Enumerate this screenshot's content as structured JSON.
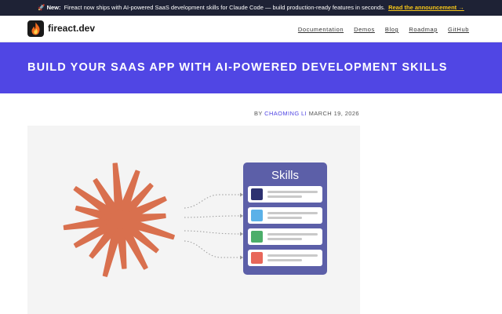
{
  "announcement": {
    "badge": "New:",
    "text": "Fireact now ships with AI-powered SaaS development skills for Claude Code — build production-ready features in seconds.",
    "link_label": "Read the announcement →"
  },
  "brand": {
    "name": "fireact.dev",
    "logo_icon": "flame-icon"
  },
  "nav": {
    "items": [
      {
        "label": "Documentation"
      },
      {
        "label": "Demos"
      },
      {
        "label": "Blog"
      },
      {
        "label": "Roadmap"
      },
      {
        "label": "GitHub"
      }
    ]
  },
  "hero": {
    "title": "BUILD YOUR SAAS APP WITH AI-POWERED DEVELOPMENT SKILLS"
  },
  "post": {
    "by_label": "BY",
    "author": "CHAOMING LI",
    "date": "MARCH 19, 2026"
  },
  "illustration": {
    "panel_title": "Skills",
    "skill_colors": [
      "#2d3170",
      "#5bb1e8",
      "#4cae6a",
      "#e8675a"
    ],
    "starburst_color": "#d9704e",
    "panel_color": "#5c5fa8"
  }
}
